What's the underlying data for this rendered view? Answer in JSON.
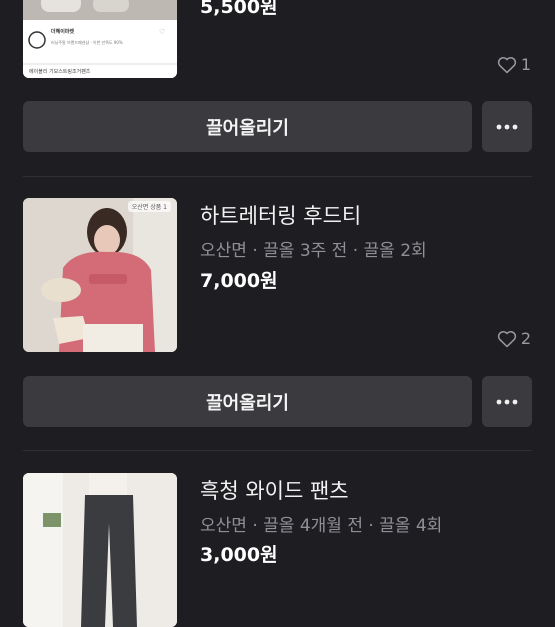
{
  "listings": [
    {
      "price": "5,500원",
      "likes": "1",
      "thumb_card_brand": "더혜이마켓",
      "thumb_card_desc": "러닝주말 브랜드패션샵 · 이번 만족도 90%",
      "thumb_caption": "에이블리 기모스트링조거팬츠",
      "bump_label": "끌어올리기"
    },
    {
      "title": "하트레터링 후드티",
      "meta": "오산면 · 끌올 3주 전 · 끌올 2회",
      "price": "7,000원",
      "likes": "2",
      "thumb_tag": "오산면 상품 1",
      "bump_label": "끌어올리기"
    },
    {
      "title": "흑청 와이드 팬츠",
      "meta": "오산면 · 끌올 4개월 전 · 끌올 4회",
      "price": "3,000원"
    }
  ],
  "colors": {
    "background": "#1e1e22",
    "button_bg": "#3a3a3f",
    "muted_text": "#8f8f96"
  }
}
